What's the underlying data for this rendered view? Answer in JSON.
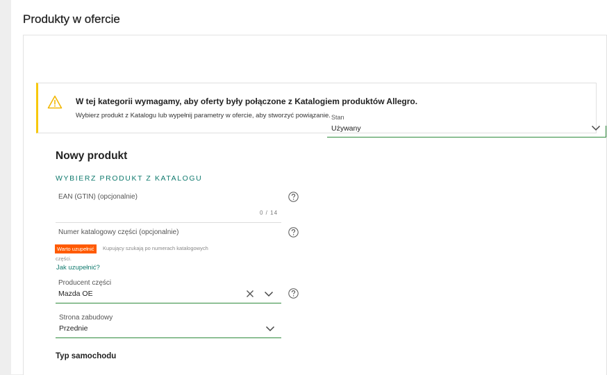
{
  "section": {
    "title": "Produkty w ofercie"
  },
  "alert": {
    "icon": "warning-triangle-icon",
    "accent_color": "#f7c80b",
    "title": "W tej kategorii wymagamy, aby oferty były połączone z Katalogiem produktów Allegro.",
    "text": "Wybierz produkt z Katalogu lub wypełnij parametry w ofercie, aby stworzyć powiązanie."
  },
  "product": {
    "title": "Nowy produkt",
    "catalog_link": "WYBIERZ PRODUKT Z KATALOGU"
  },
  "condition": {
    "label": "Stan",
    "value": "Używany"
  },
  "fields": {
    "ean": {
      "label": "EAN (GTIN) (opcjonalnie)",
      "counter": "0 / 14",
      "value": ""
    },
    "catalog_number": {
      "label": "Numer katalogowy części (opcjonalnie)",
      "value": "",
      "badge": "Warto uzupełnić",
      "hint_line1": "Kupujący szukają po numerach katalogowych",
      "hint_line2": "części.",
      "howto_link": "Jak uzupełnić?"
    },
    "manufacturer": {
      "label": "Producent części",
      "value": "Mazda OE"
    },
    "mount_side": {
      "label": "Strona zabudowy",
      "value": "Przednie"
    }
  },
  "car_type": {
    "title": "Typ samochodu"
  },
  "colors": {
    "link": "#107a6e",
    "valid_underline": "#2e8a3c",
    "badge": "#ff5a00"
  }
}
